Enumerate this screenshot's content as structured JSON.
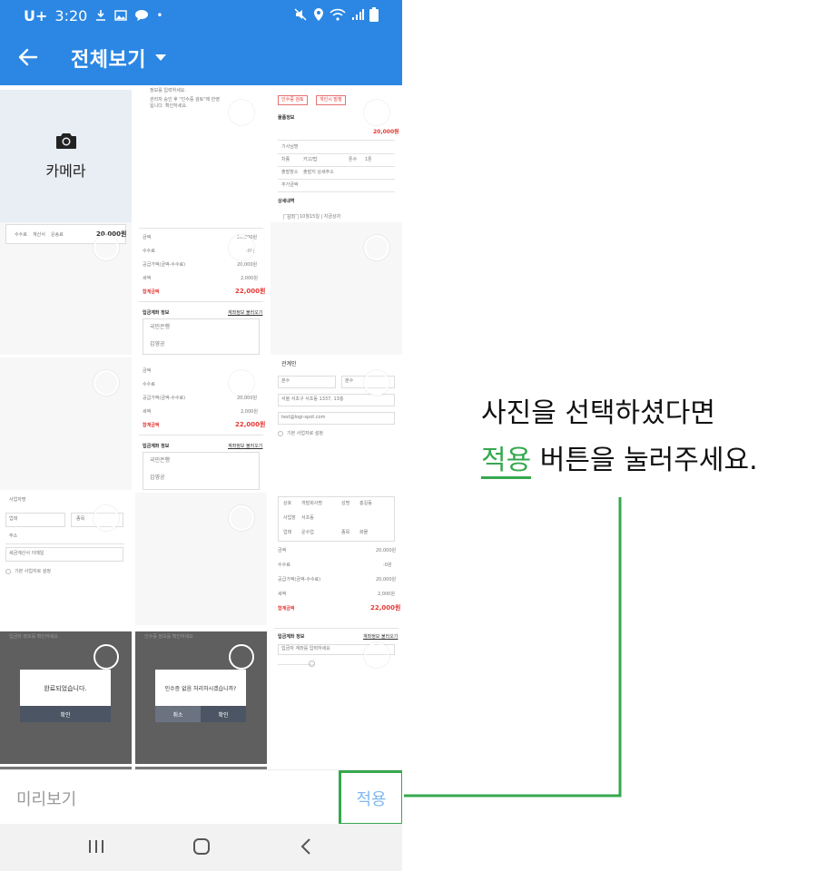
{
  "status_bar": {
    "carrier": "U+",
    "time": "3:20",
    "dot": "•",
    "icons": [
      "download-icon",
      "image-icon",
      "talk-icon",
      "mute-icon",
      "location-icon",
      "wifi-icon",
      "signal-icon",
      "battery-icon"
    ]
  },
  "app_bar": {
    "title": "전체보기",
    "back_icon": "back-arrow-icon",
    "dropdown_icon": "caret-down-icon"
  },
  "camera_tile": {
    "label": "카메라",
    "icon": "camera-icon"
  },
  "thumbs": {
    "t2": {
      "l1": "정보를 입력하세요.",
      "l2": "관리자 승인 후 \"인수증 검토\"에 반영",
      "l3": "됩니다. 확인하세요."
    },
    "t3": {
      "tag1": "인수증 검토",
      "tag2": "개인시 발행",
      "section": "물품정보",
      "price": "20,000원",
      "r1": "기사님명",
      "r2": "차종",
      "r2v": "카고/탑",
      "r2b": "톤수",
      "r2bv": "1톤",
      "r3": "출발장소",
      "r3v": "출발지 상세주소",
      "r4": "추가금액",
      "detail": "상세내역",
      "chip": "상차",
      "chip_text": "10월15일 | 지금상차"
    },
    "t4": {
      "a": "수수료",
      "b": "계산서",
      "c": "운송료",
      "price": "20,000원"
    },
    "t5": {
      "r1": "금액",
      "r1v": "20,000원",
      "r2": "수수료",
      "r2v": "-0원",
      "r3": "공급가액(금액-수수료)",
      "r3v": "20,000원",
      "r4": "세액",
      "r4v": "2,000원",
      "r5": "합계금액",
      "r5v": "22,000원",
      "section": "입금계좌 정보",
      "link": "계좌정보 불러오기",
      "bank": "국민은행",
      "holder": "김영공"
    },
    "t9": {
      "name": "관계인",
      "field1": "분수",
      "field2": "분수",
      "addr": "서울 서초구 서초동 1337, 13층",
      "email": "test@logi-spot.com",
      "checkbox": "기본 사업자로 설정"
    },
    "t10": {
      "label": "사업자명",
      "f1": "업태",
      "f2": "종목",
      "f3": "주소",
      "f4": "세금계산서 이메일",
      "checkbox": "기본 사업자로 설정"
    },
    "t12": {
      "a": "상호",
      "av": "개발회사명",
      "b": "성명",
      "bv": "홍길동",
      "c": "사업장",
      "cv": "서초동",
      "d": "업태",
      "dv": "운수업",
      "e": "종목",
      "ev": "화물",
      "section": "입금계좌 정보",
      "link": "계좌정보 불러오기",
      "hint": "입금자 계좌를 입력하세요"
    },
    "t13": {
      "top": "입금자 정보를 확인하세요",
      "msg": "완료되었습니다.",
      "btn": "확인"
    },
    "t14": {
      "top": "인수증 정보를 확인하세요",
      "msg": "인수증 없음 처리하시겠습니까?",
      "btn1": "취소",
      "btn2": "확인"
    }
  },
  "bottom_bar": {
    "preview": "미리보기",
    "apply": "적용"
  },
  "nav_bar": {
    "recent": "recent-apps-icon",
    "home": "home-icon",
    "back": "nav-back-icon"
  },
  "annotation": {
    "line1": "사진을 선택하셨다면",
    "highlight": "적용",
    "line2_rest": " 버튼을 눌러주세요."
  },
  "colors": {
    "primary": "#2b87e3",
    "highlight_green": "#36a84f",
    "apply_text": "#7fb9f0",
    "camera_bg": "#e9edf4",
    "dark_tile": "#5f5f5f"
  }
}
